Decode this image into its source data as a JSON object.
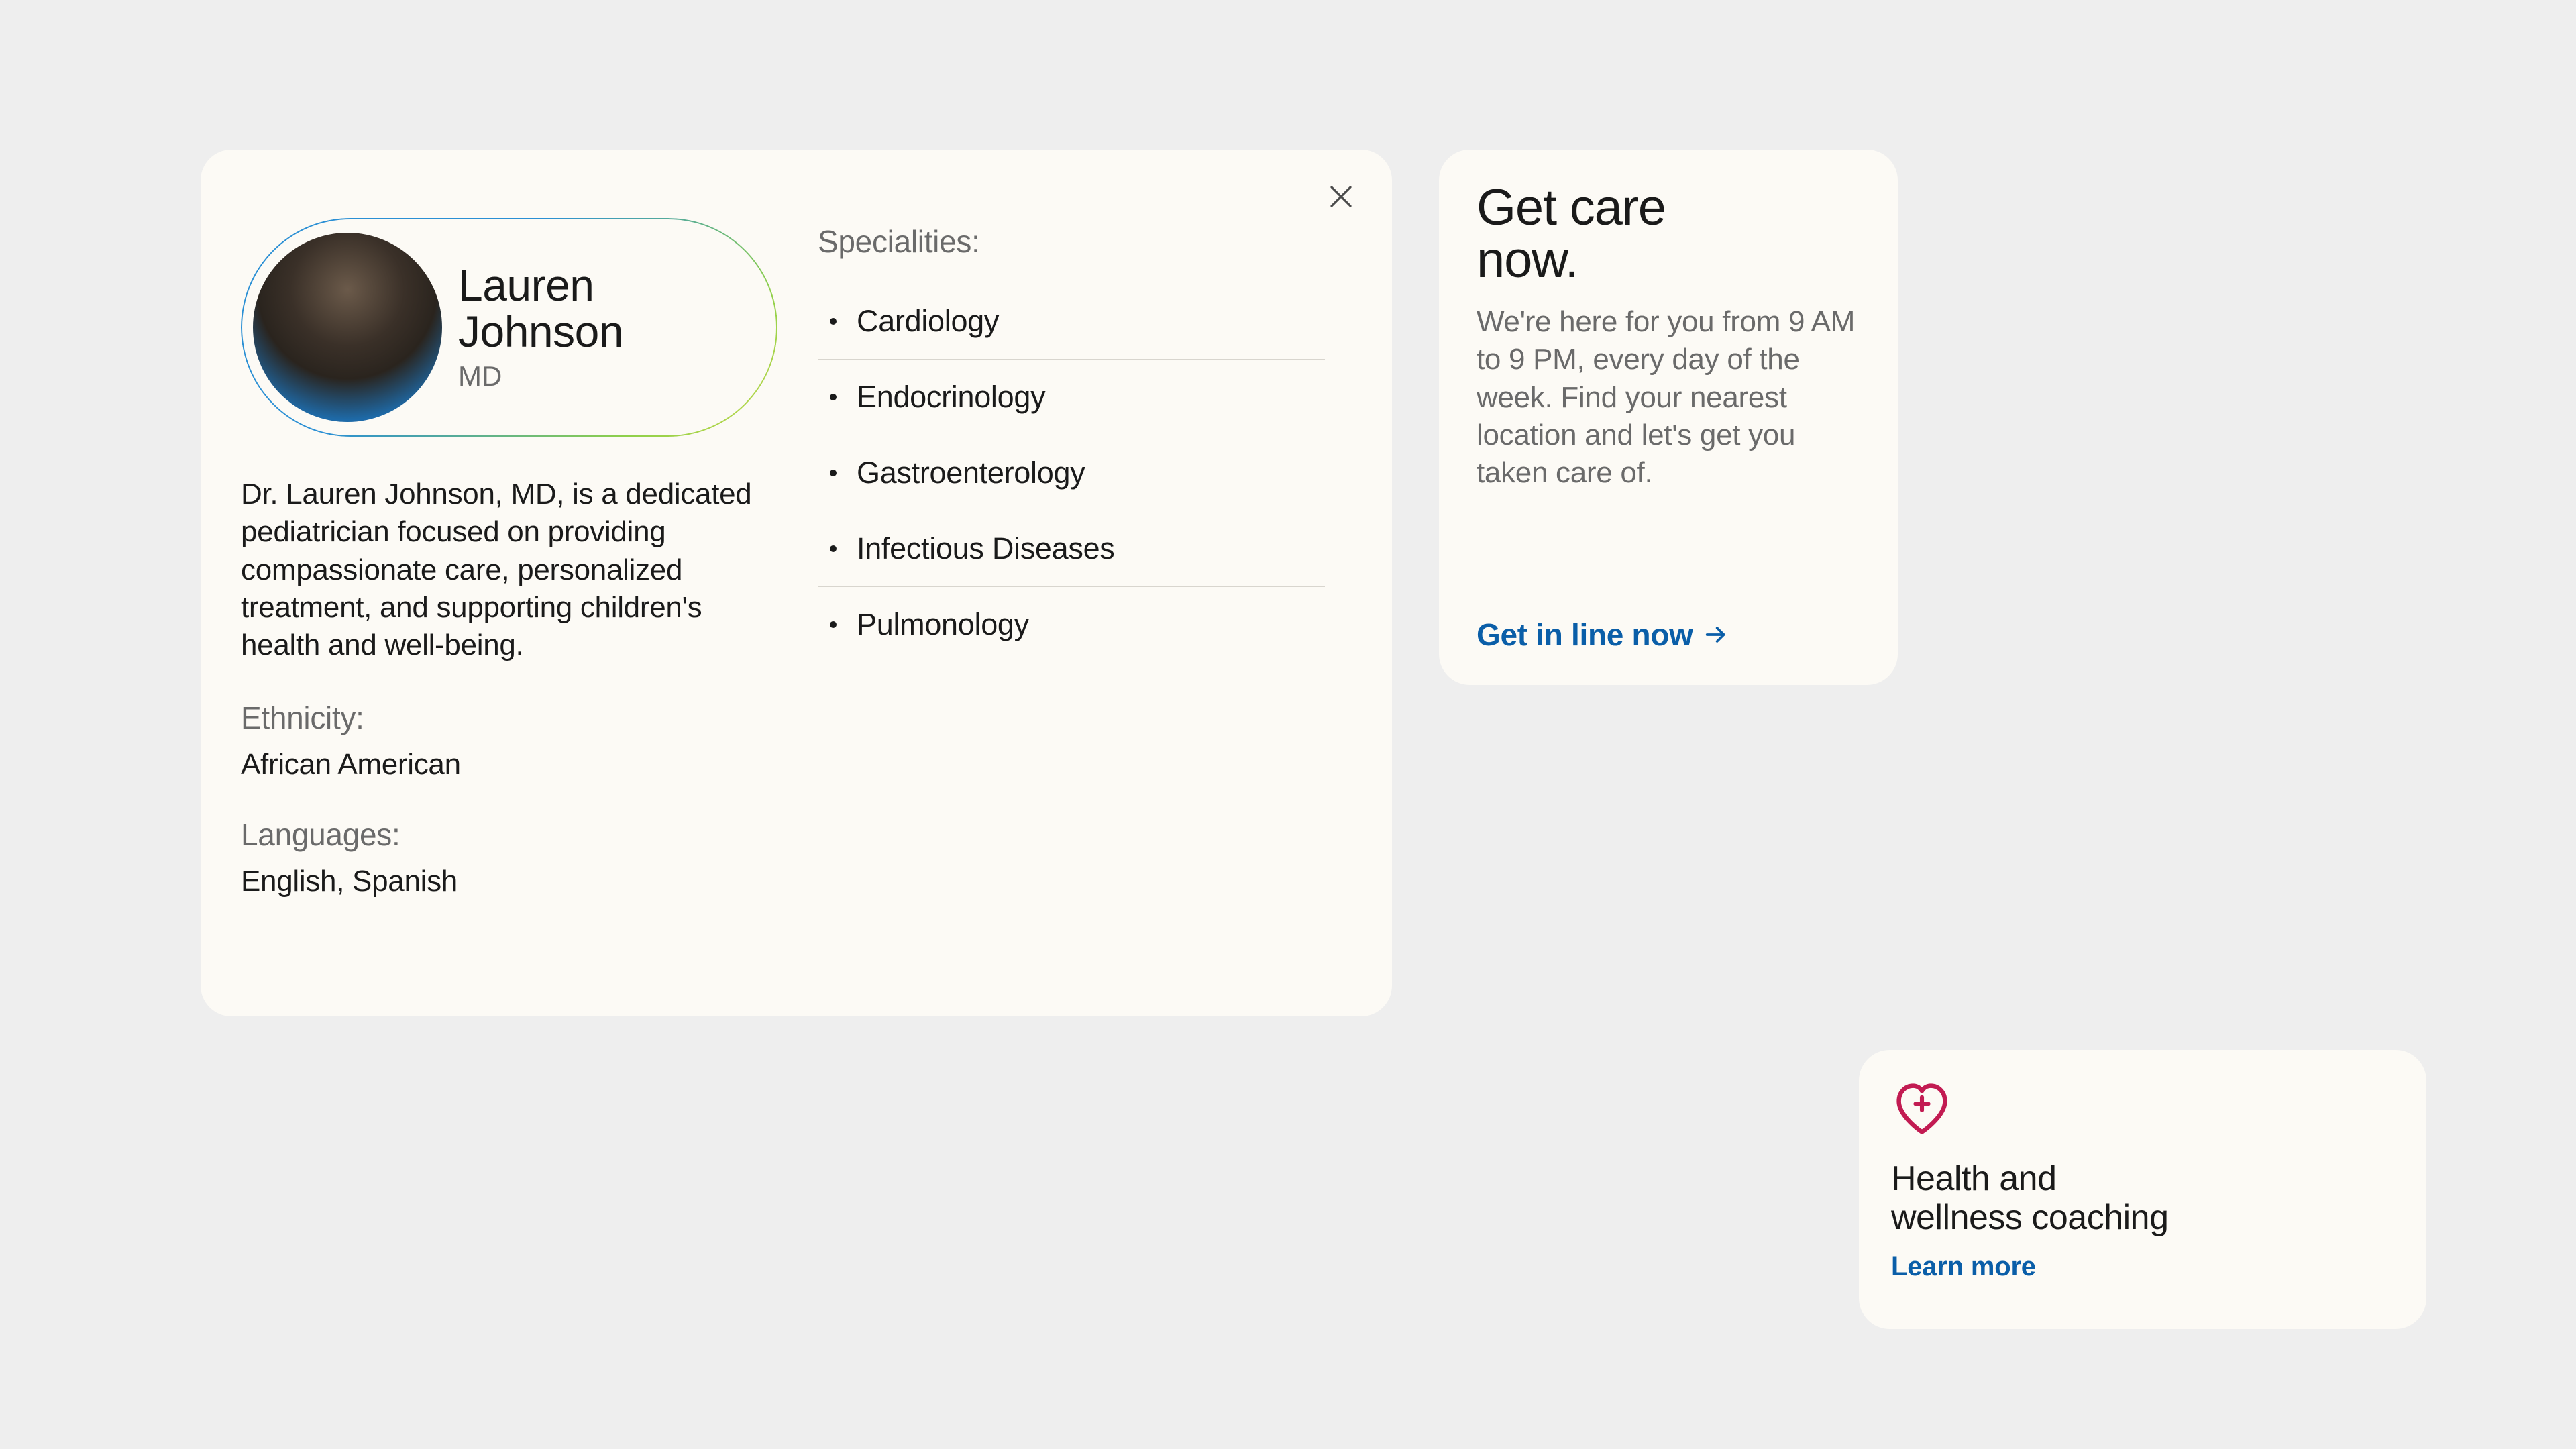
{
  "profile": {
    "name_line1": "Lauren",
    "name_line2": "Johnson",
    "credential": "MD",
    "bio": "Dr. Lauren Johnson, MD, is a dedicated pediatrician focused on providing compassionate care, personalized treatment, and supporting children's health and well-being.",
    "ethnicity_label": "Ethnicity:",
    "ethnicity_value": "African American",
    "languages_label": "Languages:",
    "languages_value": "English, Spanish",
    "specialities_label": "Specialities:",
    "specialities": [
      "Cardiology",
      "Endocrinology",
      "Gastroenterology",
      "Infectious Diseases",
      "Pulmonology"
    ]
  },
  "care": {
    "title_line1": "Get care",
    "title_line2": "now.",
    "body": "We're here for you from 9 AM to 9 PM, every day of the week. Find your nearest location and let's get you taken care of.",
    "cta": "Get in line now"
  },
  "coaching": {
    "title_line1": "Health and",
    "title_line2": "wellness coaching",
    "cta": "Learn more"
  },
  "colors": {
    "link": "#0a5ea8",
    "heart": "#c21b52"
  }
}
